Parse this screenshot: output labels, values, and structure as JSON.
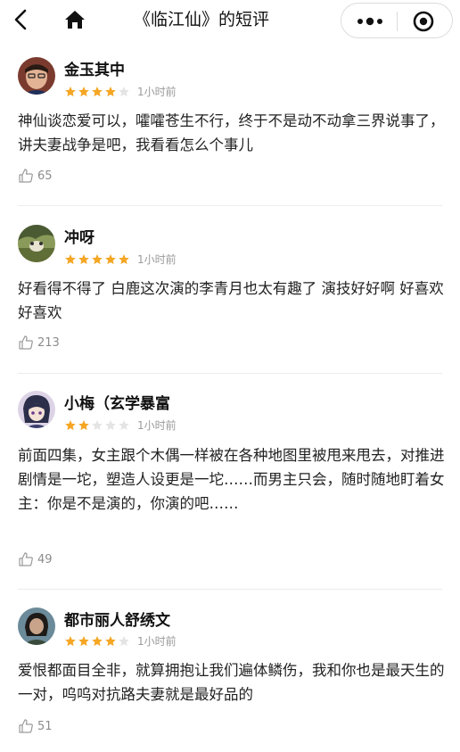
{
  "header": {
    "title": "《临江仙》的短评",
    "back_icon": "back-chevron-icon",
    "home_icon": "home-icon",
    "more_icon": "more-dots-icon",
    "close_icon": "target-close-icon"
  },
  "colors": {
    "star_filled": "#f5a623",
    "star_empty": "#e4e4e4",
    "muted": "#9a9a9a"
  },
  "reviews": [
    {
      "user": "金玉其中",
      "rating": 4,
      "time": "1小时前",
      "text": "神仙谈恋爱可以，嚯嚯苍生不行，终于不是动不动拿三界说事了，讲夫妻战争是吧，我看看怎么个事儿",
      "likes": "65"
    },
    {
      "user": "冲呀",
      "rating": 5,
      "time": "1小时前",
      "text": "好看得不得了 白鹿这次演的李青月也太有趣了 演技好好啊 好喜欢好喜欢",
      "likes": "213"
    },
    {
      "user": "小梅（玄学暴富",
      "rating": 2,
      "time": "1小时前",
      "text": "前面四集，女主跟个木偶一样被在各种地图里被甩来甩去，对推进剧情是一坨，塑造人设更是一坨……而男主只会，随时随地盯着女主：你是不是演的，你演的吧……",
      "likes": "49"
    },
    {
      "user": "都市丽人舒绣文",
      "rating": 4,
      "time": "1小时前",
      "text": "爱恨都面目全非，就算拥抱让我们遍体鳞伤，我和你也是最天生的一对，呜呜对抗路夫妻就是最好品的",
      "likes": "51"
    }
  ]
}
